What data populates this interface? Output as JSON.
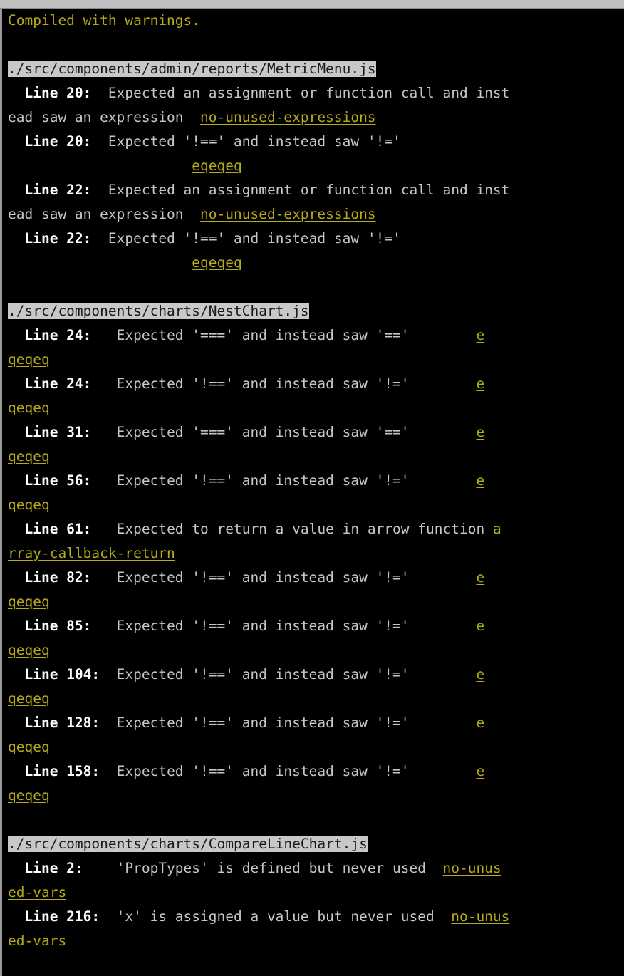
{
  "window": {
    "chrome_visible": true,
    "chrome_ghost_text": "· · ·"
  },
  "terminal": {
    "background_color": "#000000",
    "default_text_color": "#c6c6c6",
    "header_color": "#b5ab16",
    "rule_color": "#b5ab16",
    "lineno_color": "#ffffff",
    "file_header_bg": "#c8c8c8",
    "file_header_fg": "#1a1a1a",
    "wrap_columns": 59,
    "status_header": "Compiled with warnings.",
    "files": [
      {
        "path": "./src/components/admin/reports/MetricMenu.js",
        "warnings": [
          {
            "line_label": "Line 20:",
            "message": "Expected an assignment or function call and instead saw an expression",
            "rule": "no-unused-expressions"
          },
          {
            "line_label": "Line 20:",
            "message": "Expected '!==' and instead saw '!='",
            "rule": "eqeqeq"
          },
          {
            "line_label": "Line 22:",
            "message": "Expected an assignment or function call and instead saw an expression",
            "rule": "no-unused-expressions"
          },
          {
            "line_label": "Line 22:",
            "message": "Expected '!==' and instead saw '!='",
            "rule": "eqeqeq"
          }
        ]
      },
      {
        "path": "./src/components/charts/NestChart.js",
        "warnings": [
          {
            "line_label": "Line 24:",
            "message": "Expected '===' and instead saw '=='",
            "rule": "eqeqeq"
          },
          {
            "line_label": "Line 24:",
            "message": "Expected '!==' and instead saw '!='",
            "rule": "eqeqeq"
          },
          {
            "line_label": "Line 31:",
            "message": "Expected '===' and instead saw '=='",
            "rule": "eqeqeq"
          },
          {
            "line_label": "Line 56:",
            "message": "Expected '!==' and instead saw '!='",
            "rule": "eqeqeq"
          },
          {
            "line_label": "Line 61:",
            "message": "Expected to return a value in arrow function",
            "rule": "array-callback-return"
          },
          {
            "line_label": "Line 82:",
            "message": "Expected '!==' and instead saw '!='",
            "rule": "eqeqeq"
          },
          {
            "line_label": "Line 85:",
            "message": "Expected '!==' and instead saw '!='",
            "rule": "eqeqeq"
          },
          {
            "line_label": "Line 104:",
            "message": "Expected '!==' and instead saw '!='",
            "rule": "eqeqeq"
          },
          {
            "line_label": "Line 128:",
            "message": "Expected '!==' and instead saw '!='",
            "rule": "eqeqeq"
          },
          {
            "line_label": "Line 158:",
            "message": "Expected '!==' and instead saw '!='",
            "rule": "eqeqeq"
          }
        ]
      },
      {
        "path": "./src/components/charts/CompareLineChart.js",
        "warnings": [
          {
            "line_label": "Line 2:",
            "message": "'PropTypes' is defined but never used",
            "rule": "no-unused-vars"
          },
          {
            "line_label": "Line 216:",
            "message": "'x' is assigned a value but never used",
            "rule": "no-unused-vars"
          }
        ]
      }
    ],
    "rendered_lines": [
      {
        "type": "header",
        "text": "Compiled with warnings."
      },
      {
        "type": "blank",
        "text": ""
      },
      {
        "type": "file",
        "text": "./src/components/admin/reports/MetricMenu.js"
      },
      {
        "type": "warn",
        "lineno": "  Line 20:  ",
        "msg": "Expected an assignment or function call and inst"
      },
      {
        "type": "cont",
        "msg": "ead saw an expression  ",
        "rule": "no-unused-expressions"
      },
      {
        "type": "warn",
        "lineno": "  Line 20:  ",
        "msg": "Expected '!==' and instead saw '!='"
      },
      {
        "type": "cont",
        "msg": "                      ",
        "rule": "eqeqeq"
      },
      {
        "type": "warn",
        "lineno": "  Line 22:  ",
        "msg": "Expected an assignment or function call and inst"
      },
      {
        "type": "cont",
        "msg": "ead saw an expression  ",
        "rule": "no-unused-expressions"
      },
      {
        "type": "warn",
        "lineno": "  Line 22:  ",
        "msg": "Expected '!==' and instead saw '!='"
      },
      {
        "type": "cont",
        "msg": "                      ",
        "rule": "eqeqeq"
      },
      {
        "type": "blank",
        "text": ""
      },
      {
        "type": "file",
        "text": "./src/components/charts/NestChart.js"
      },
      {
        "type": "warn",
        "lineno": "  Line 24:   ",
        "msg": "Expected '===' and instead saw '=='        ",
        "rule": "e"
      },
      {
        "type": "cont",
        "msg": "",
        "rule": "qeqeq"
      },
      {
        "type": "warn",
        "lineno": "  Line 24:   ",
        "msg": "Expected '!==' and instead saw '!='        ",
        "rule": "e"
      },
      {
        "type": "cont",
        "msg": "",
        "rule": "qeqeq"
      },
      {
        "type": "warn",
        "lineno": "  Line 31:   ",
        "msg": "Expected '===' and instead saw '=='        ",
        "rule": "e"
      },
      {
        "type": "cont",
        "msg": "",
        "rule": "qeqeq"
      },
      {
        "type": "warn",
        "lineno": "  Line 56:   ",
        "msg": "Expected '!==' and instead saw '!='        ",
        "rule": "e"
      },
      {
        "type": "cont",
        "msg": "",
        "rule": "qeqeq"
      },
      {
        "type": "warn",
        "lineno": "  Line 61:   ",
        "msg": "Expected to return a value in arrow function ",
        "rule": "a"
      },
      {
        "type": "cont",
        "msg": "",
        "rule": "rray-callback-return"
      },
      {
        "type": "warn",
        "lineno": "  Line 82:   ",
        "msg": "Expected '!==' and instead saw '!='        ",
        "rule": "e"
      },
      {
        "type": "cont",
        "msg": "",
        "rule": "qeqeq"
      },
      {
        "type": "warn",
        "lineno": "  Line 85:   ",
        "msg": "Expected '!==' and instead saw '!='        ",
        "rule": "e"
      },
      {
        "type": "cont",
        "msg": "",
        "rule": "qeqeq"
      },
      {
        "type": "warn",
        "lineno": "  Line 104:  ",
        "msg": "Expected '!==' and instead saw '!='        ",
        "rule": "e"
      },
      {
        "type": "cont",
        "msg": "",
        "rule": "qeqeq"
      },
      {
        "type": "warn",
        "lineno": "  Line 128:  ",
        "msg": "Expected '!==' and instead saw '!='        ",
        "rule": "e"
      },
      {
        "type": "cont",
        "msg": "",
        "rule": "qeqeq"
      },
      {
        "type": "warn",
        "lineno": "  Line 158:  ",
        "msg": "Expected '!==' and instead saw '!='        ",
        "rule": "e"
      },
      {
        "type": "cont",
        "msg": "",
        "rule": "qeqeq"
      },
      {
        "type": "blank",
        "text": ""
      },
      {
        "type": "file",
        "text": "./src/components/charts/CompareLineChart.js"
      },
      {
        "type": "warn",
        "lineno": "  Line 2:    ",
        "msg": "'PropTypes' is defined but never used  ",
        "rule": "no-unus"
      },
      {
        "type": "cont",
        "msg": "",
        "rule": "ed-vars"
      },
      {
        "type": "warn",
        "lineno": "  Line 216:  ",
        "msg": "'x' is assigned a value but never used  ",
        "rule": "no-unus"
      },
      {
        "type": "cont",
        "msg": "",
        "rule": "ed-vars"
      }
    ]
  }
}
